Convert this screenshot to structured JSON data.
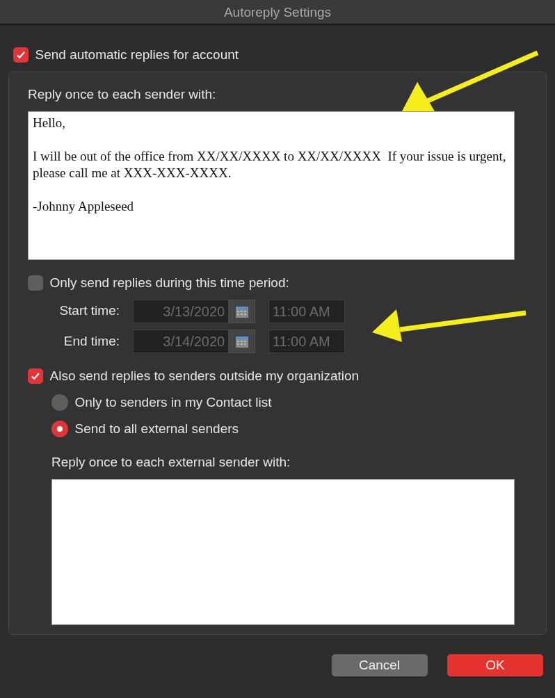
{
  "window": {
    "title": "Autoreply Settings"
  },
  "enable": {
    "label": "Send automatic replies for account",
    "checked": true
  },
  "internal": {
    "label": "Reply once to each sender with:",
    "paragraphs": [
      "Hello,",
      "I will be out of the office from XX/XX/XXXX to XX/XX/XXXX  If your issue is urgent, please call me at XXX-XXX-XXXX.",
      "-Johnny Appleseed"
    ]
  },
  "time_period": {
    "label": "Only send replies during this time period:",
    "checked": false,
    "disabled": true,
    "rows": [
      {
        "label": "Start time:",
        "date": "3/13/2020",
        "time": "11:00 AM"
      },
      {
        "label": "End time:",
        "date": "3/14/2020",
        "time": "11:00 AM"
      }
    ]
  },
  "external": {
    "label": "Also send replies to senders outside my organization",
    "checked": true,
    "options": [
      {
        "label": "Only to senders in my Contact list",
        "selected": false
      },
      {
        "label": "Send to all external senders",
        "selected": true
      }
    ],
    "message_label": "Reply once to each external sender with:"
  },
  "buttons": [
    {
      "label": "Cancel",
      "kind": "secondary"
    },
    {
      "label": "OK",
      "kind": "primary"
    }
  ]
}
